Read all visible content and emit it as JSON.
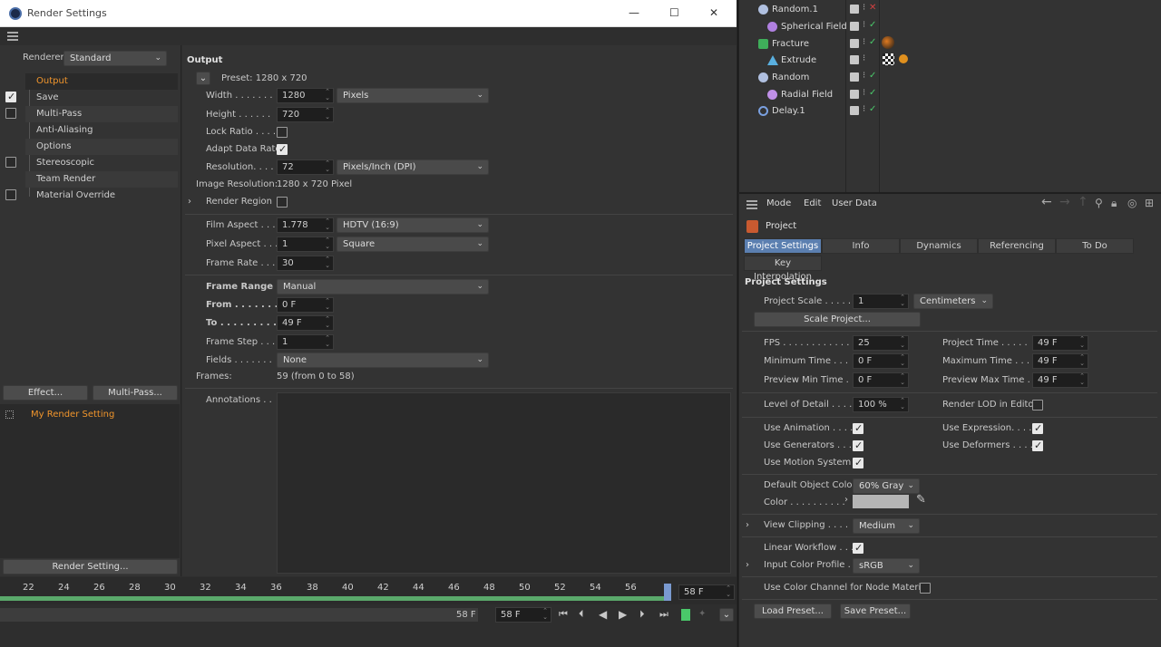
{
  "window": {
    "title": "Render Settings",
    "min": "—",
    "max": "☐",
    "close": "✕"
  },
  "left": {
    "renderer_label": "Renderer",
    "renderer_value": "Standard",
    "items": [
      {
        "label": "Output",
        "checked": null,
        "active": true
      },
      {
        "label": "Save",
        "checked": true
      },
      {
        "label": "Multi-Pass",
        "checked": false
      },
      {
        "label": "Anti-Aliasing",
        "checked": null
      },
      {
        "label": "Options",
        "checked": null
      },
      {
        "label": "Stereoscopic",
        "checked": false
      },
      {
        "label": "Team Render",
        "checked": null
      },
      {
        "label": "Material Override",
        "checked": false
      }
    ],
    "effect_btn": "Effect...",
    "multipass_btn": "Multi-Pass...",
    "my_setting": "My Render Setting",
    "render_setting_btn": "Render Setting..."
  },
  "output": {
    "heading": "Output",
    "preset": "Preset: 1280 x 720",
    "width_label": "Width . . . . . . .",
    "width": "1280",
    "width_unit": "Pixels",
    "height_label": "Height . . . . . .",
    "height": "720",
    "lock_label": "Lock Ratio . . . .",
    "adapt_label": "Adapt Data Rate",
    "res_label": "Resolution. . . .",
    "res": "72",
    "res_unit": "Pixels/Inch (DPI)",
    "img_res_label": "Image Resolution:",
    "img_res": "1280 x 720 Pixel",
    "region_label": "Render Region",
    "film_label": "Film Aspect . . .",
    "film": "1.778",
    "film_preset": "HDTV (16:9)",
    "pixel_label": "Pixel Aspect . . .",
    "pixel": "1",
    "pixel_preset": "Square",
    "fps_label": "Frame Rate . . .",
    "fps": "30",
    "range_label": "Frame Range .",
    "range": "Manual",
    "from_label": "From . . . . . . .",
    "from": "0 F",
    "to_label": "To . . . . . . . . .",
    "to": "49 F",
    "step_label": "Frame Step . . .",
    "step": "1",
    "fields_label": "Fields . . . . . . .",
    "fields": "None",
    "frames_label": "Frames:",
    "frames": "59 (from 0 to 58)",
    "annotations_label": "Annotations . ."
  },
  "timeline": {
    "ticks": [
      "22",
      "24",
      "26",
      "28",
      "30",
      "32",
      "34",
      "36",
      "38",
      "40",
      "42",
      "44",
      "46",
      "48",
      "50",
      "52",
      "54",
      "56"
    ],
    "current": "58 F",
    "end_field": "58 F",
    "frame_field": "58 F"
  },
  "objects": [
    {
      "name": "Random.1",
      "indent": 0
    },
    {
      "name": "Spherical Field",
      "indent": 1
    },
    {
      "name": "Fracture",
      "indent": 0
    },
    {
      "name": "Extrude",
      "indent": 1
    },
    {
      "name": "Random",
      "indent": 0
    },
    {
      "name": "Radial Field",
      "indent": 1
    },
    {
      "name": "Delay.1",
      "indent": 0
    }
  ],
  "attr": {
    "menu": [
      "Mode",
      "Edit",
      "User Data"
    ],
    "title": "Project",
    "tabs": [
      "Project Settings",
      "Info",
      "Dynamics",
      "Referencing",
      "To Do"
    ],
    "tab2": "Key Interpolation",
    "section": "Project Settings",
    "scale_label": "Project Scale . . . . .",
    "scale": "1",
    "scale_unit": "Centimeters",
    "scale_btn": "Scale Project...",
    "fps_label": "FPS . . . . . . . . . . . .",
    "fps": "25",
    "ptime_label": "Project Time . . . . .",
    "ptime": "49 F",
    "mintime_label": "Minimum Time . . .",
    "mintime": "0 F",
    "maxtime_label": "Maximum Time . . .",
    "maxtime": "49 F",
    "prevmin_label": "Preview Min Time . .",
    "prevmin": "0 F",
    "prevmax_label": "Preview Max Time . .",
    "prevmax": "49 F",
    "lod_label": "Level of Detail . . . .",
    "lod": "100 %",
    "renderlod_label": "Render LOD in Editor",
    "useanim_label": "Use Animation . . . .",
    "useexpr_label": "Use Expression. . . .",
    "usegen_label": "Use Generators . . .",
    "usedef_label": "Use Deformers . . . .",
    "usemotion_label": "Use Motion System",
    "defcolor_label": "Default Object Color",
    "defcolor": "60% Gray",
    "color_label": "Color . . . . . . . . . .",
    "clip_label": "View Clipping . . . .",
    "clip": "Medium",
    "linear_label": "Linear Workflow . . .",
    "profile_label": "Input Color Profile . .",
    "profile": "sRGB",
    "nodemat_label": "Use Color Channel for Node Material",
    "load_btn": "Load Preset...",
    "save_btn": "Save Preset..."
  }
}
